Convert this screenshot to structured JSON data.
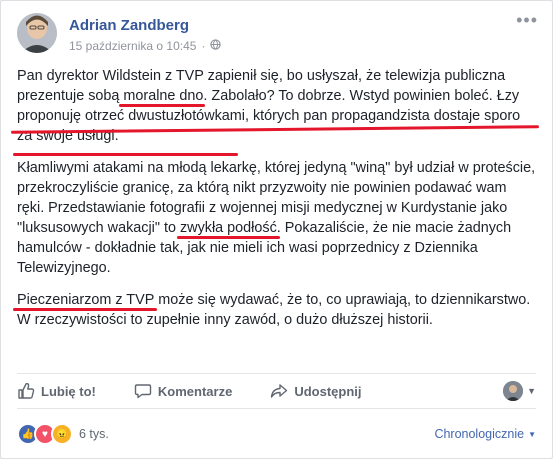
{
  "post": {
    "author": "Adrian Zandberg",
    "timestamp": "15 października o 10:45",
    "privacy_separator": "·",
    "paragraphs": {
      "p1": {
        "a": "Pan dyrektor Wildstein z TVP zapienił się, bo usłyszał, że telewizja publiczna prezentuje sobą ",
        "u1": "moralne dno",
        "b": ". Zabolało? To dobrze. Wstyd powinien boleć. ",
        "u2": "Łzy proponuję otrzeć dwustuzłotówkami, których pan propagandzista dostaje sporo za swoje usługi."
      },
      "p2": {
        "a": "Kłamliwymi atakami na młodą lekarkę, której jedyną \"winą\" był udział w proteście, przekroczyliście granicę, za którą nikt przyzwoity nie powinien podawać wam ręki. Przedstawianie fotografii z wojennej misji medycznej w Kurdystanie jako \"luksusowych wakacji\" to ",
        "u1": "zwykła podłość",
        "b": ". Pokazaliście, że nie macie żadnych hamulców - dokładnie tak, jak nie mieli ich wasi poprzednicy z Dziennika Telewizyjnego."
      },
      "p3": {
        "u1": "Pieczeniarzom z TVP",
        "b": " może się wydawać, że to, co uprawiają, to dziennikarstwo. W rzeczywistości to zupełnie inny zawód, o dużo dłuższej historii."
      }
    }
  },
  "actions": {
    "like": "Lubię to!",
    "comment": "Komentarze",
    "share": "Udostępnij"
  },
  "footer": {
    "reactions_count": "6 tys.",
    "sort_label": "Chronologicznie"
  },
  "colors": {
    "link": "#365899",
    "underline": "#e3162b",
    "like_blue": "#4267b2",
    "love_red": "#f25268",
    "angry_orange": "#f7b125"
  }
}
